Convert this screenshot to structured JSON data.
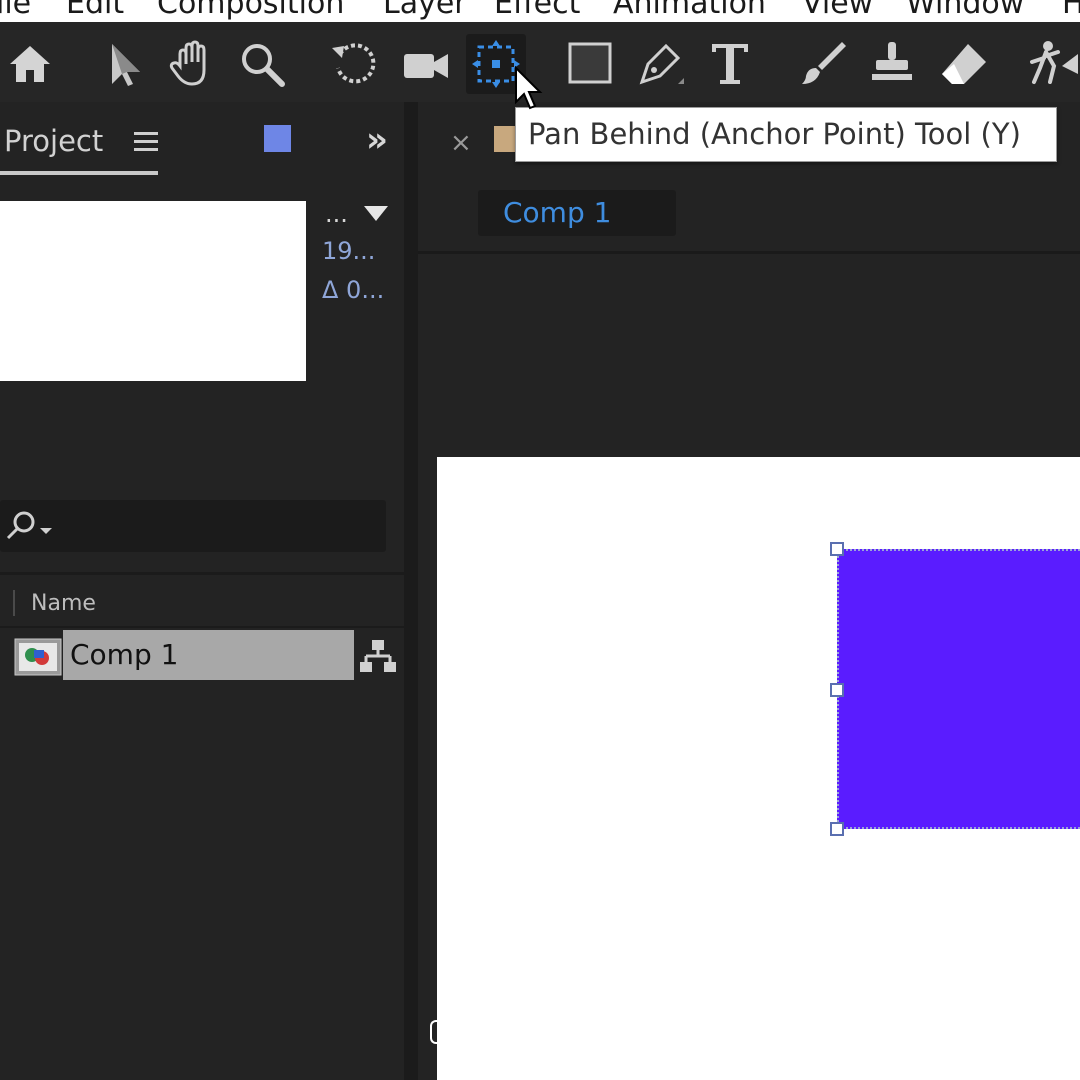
{
  "menu": {
    "items": [
      "ile",
      "Edit",
      "Composition",
      "Layer",
      "Effect",
      "Animation",
      "View",
      "Window",
      "H"
    ]
  },
  "toolbar": {
    "tools": [
      {
        "icon": "home-icon"
      },
      {
        "icon": "selection-arrow-icon"
      },
      {
        "icon": "hand-icon"
      },
      {
        "icon": "zoom-magnifier-icon"
      },
      {
        "icon": "rotate-icon"
      },
      {
        "icon": "camera-icon"
      },
      {
        "icon": "pan-behind-icon",
        "active": true
      },
      {
        "icon": "rectangle-icon"
      },
      {
        "icon": "pen-icon"
      },
      {
        "icon": "type-icon"
      },
      {
        "icon": "brush-icon"
      },
      {
        "icon": "clone-stamp-icon"
      },
      {
        "icon": "eraser-icon"
      },
      {
        "icon": "puppet-icon"
      }
    ]
  },
  "tooltip": {
    "text": "Pan Behind (Anchor Point) Tool (Y)"
  },
  "project_panel": {
    "title": "Project",
    "info_dots": "...",
    "info_line1": "19...",
    "info_line2": "Δ 0...",
    "column_name": "Name",
    "items": [
      {
        "label": "Comp 1",
        "selected": true
      }
    ]
  },
  "composition_panel": {
    "tab_label": "Comp 1",
    "canvas_color": "#ffffff",
    "shape_color": "#5a1cff"
  },
  "colors": {
    "accent_blue": "#3f8ddf",
    "project_chip": "#6e86e6",
    "comp_chip": "#c8a87e"
  }
}
